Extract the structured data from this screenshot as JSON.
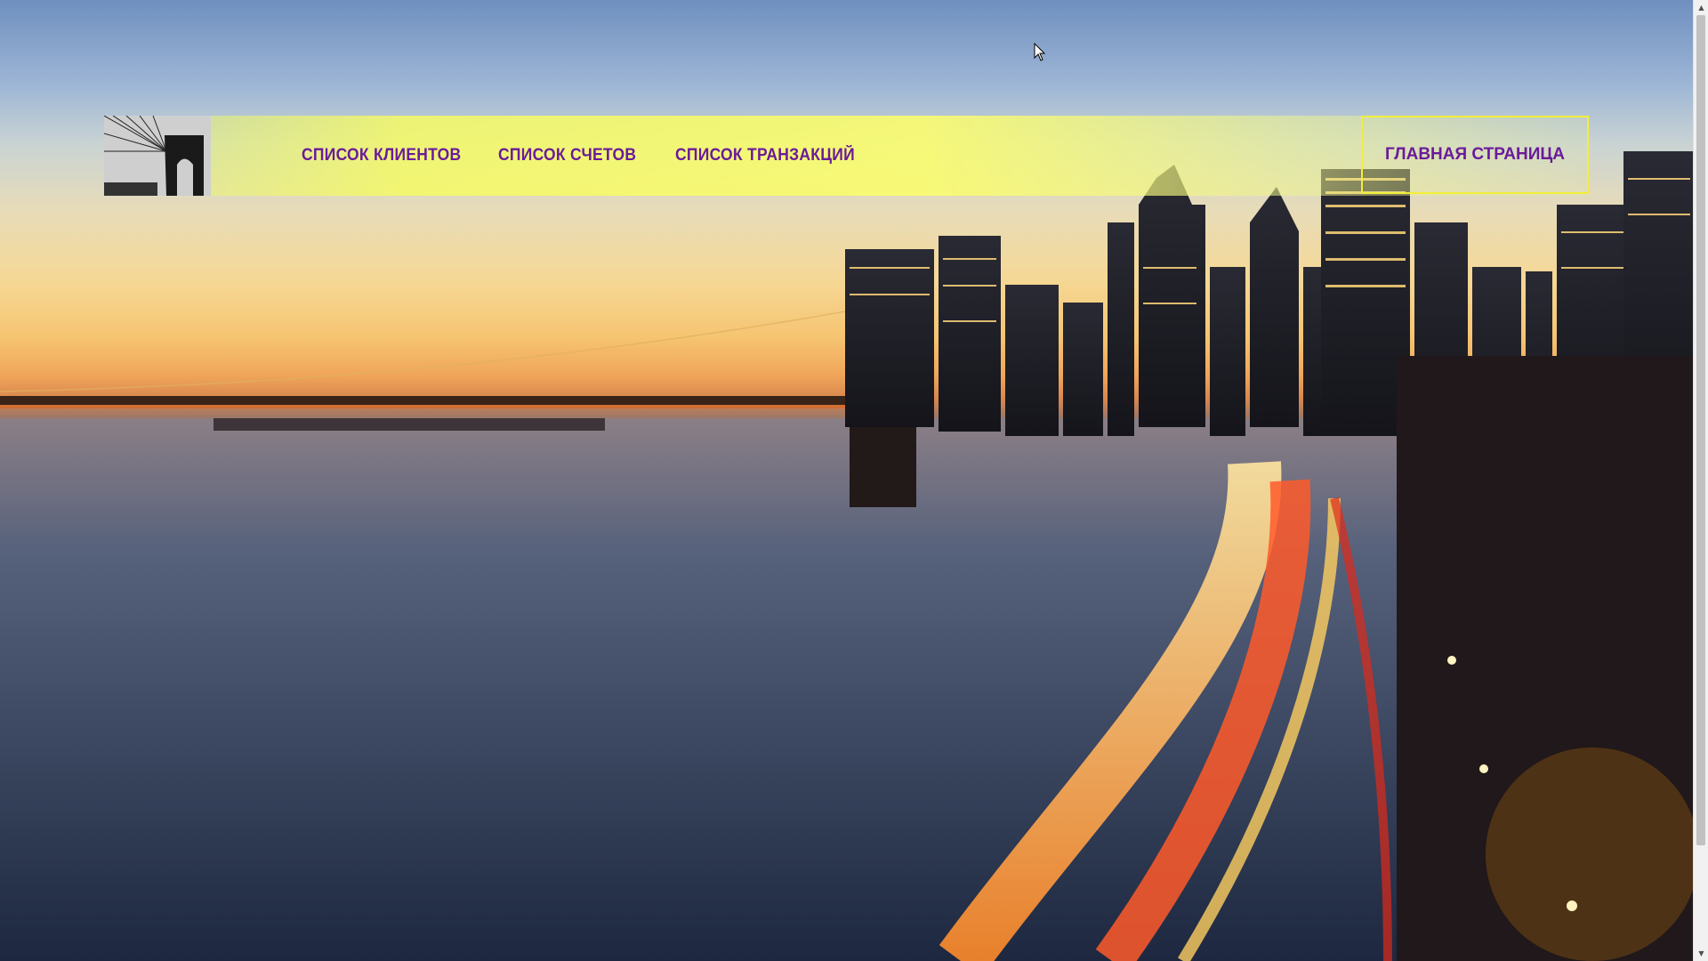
{
  "nav": {
    "links": [
      {
        "label": "СПИСОК КЛИЕНТОВ"
      },
      {
        "label": "СПИСОК СЧЕТОВ"
      },
      {
        "label": "СПИСОК ТРАНЗАКЦИЙ"
      }
    ],
    "home_label": "ГЛАВНАЯ СТРАНИЦА"
  },
  "colors": {
    "nav_text": "#6a1b9a",
    "nav_bar": "#f5f76a",
    "home_border": "#f2ee3b"
  },
  "icons": {
    "logo": "bridge-photo-logo",
    "background": "city-night-skyline-photo",
    "cursor": "mouse-pointer-icon"
  }
}
